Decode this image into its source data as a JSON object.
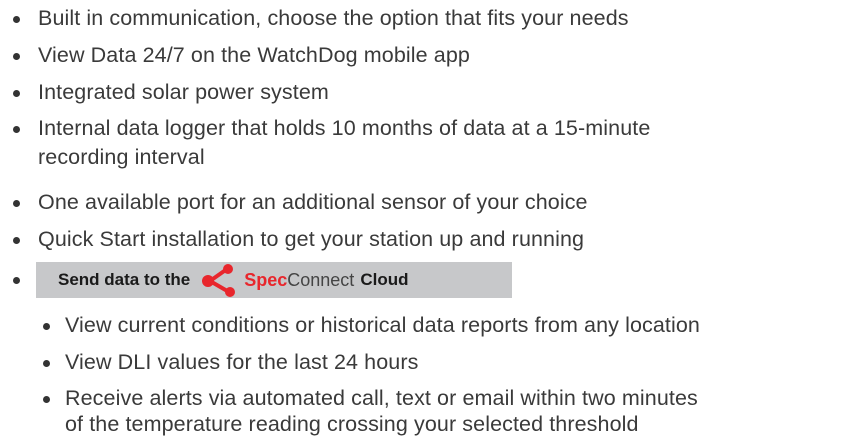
{
  "items": [
    "Built in communication, choose the option that fits your needs",
    "View Data 24/7 on the WatchDog mobile app",
    "Integrated solar power system",
    "Internal data logger that holds 10 months of data at a 15-minute",
    "recording interval",
    "One available port for an additional sensor of your choice",
    "Quick Start installation to get your station up and running"
  ],
  "banner": {
    "lead": "Send data to the",
    "spec": "Spec",
    "connect": "Connect",
    "cloud": "Cloud",
    "accent_color": "#e8262c",
    "icon": "share-network-icon"
  },
  "sub_items": [
    "View current conditions or historical data reports from any location",
    "View DLI values for the last 24 hours",
    "Receive alerts via automated call, text or email within two minutes",
    "of  the temperature reading crossing your selected threshold"
  ]
}
